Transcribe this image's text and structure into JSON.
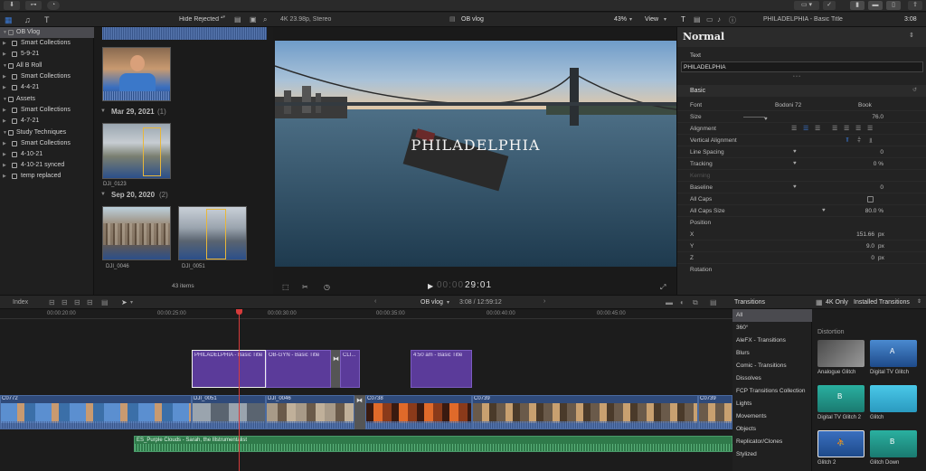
{
  "browser": {
    "filter": "Hide Rejected",
    "items_count": "43 items",
    "date1": "Mar 29, 2021",
    "date1_count": "(1)",
    "date2": "Sep 20, 2020",
    "date2_count": "(2)",
    "clip1": "DJI_0123",
    "clip2": "DJI_0046",
    "clip3": "DJI_0051"
  },
  "library": {
    "items": [
      {
        "label": "OB Vlog",
        "level": 0,
        "selected": true
      },
      {
        "label": "Smart Collections",
        "level": 1
      },
      {
        "label": "5-9-21",
        "level": 1
      },
      {
        "label": "All B Roll",
        "level": 0
      },
      {
        "label": "Smart Collections",
        "level": 1
      },
      {
        "label": "4-4-21",
        "level": 1
      },
      {
        "label": "Assets",
        "level": 0
      },
      {
        "label": "Smart Collections",
        "level": 1
      },
      {
        "label": "4-7-21",
        "level": 1
      },
      {
        "label": "Study Techniques",
        "level": 0
      },
      {
        "label": "Smart Collections",
        "level": 1
      },
      {
        "label": "4-10-21",
        "level": 1
      },
      {
        "label": "4-10-21 synced",
        "level": 1
      },
      {
        "label": "temp replaced",
        "level": 1
      }
    ]
  },
  "viewer": {
    "format": "4K 23.98p, Stereo",
    "project": "OB vlog",
    "zoom": "43%",
    "view": "View",
    "title_text": "PHILADELPHIA",
    "timecode_dim": "00:00",
    "timecode": "29:01"
  },
  "inspector": {
    "header_title": "PHILADELPHIA - Basic Title",
    "header_time": "3:08",
    "preset": "Normal",
    "text_label": "Text",
    "text_value": "PHILADELPHIA",
    "basic": "Basic",
    "rows": [
      {
        "k": "Font",
        "v": "Bodoni 72",
        "v2": "Book"
      },
      {
        "k": "Size",
        "v": "76.0"
      },
      {
        "k": "Alignment",
        "v": ""
      },
      {
        "k": "Vertical Alignment",
        "v": ""
      },
      {
        "k": "Line Spacing",
        "v": "0"
      },
      {
        "k": "Tracking",
        "v": "0 %"
      },
      {
        "k": "Kerning",
        "v": ""
      },
      {
        "k": "Baseline",
        "v": "0"
      },
      {
        "k": "All Caps",
        "v": ""
      },
      {
        "k": "All Caps Size",
        "v": "80.0 %"
      }
    ],
    "position": "Position",
    "x_label": "X",
    "x_val": "151.66",
    "x_unit": "px",
    "y_label": "Y",
    "y_val": "9.0",
    "y_unit": "px",
    "z_label": "Z",
    "z_val": "0",
    "z_unit": "px",
    "rotation": "Rotation"
  },
  "timeline": {
    "index": "Index",
    "project": "OB vlog",
    "timecode": "3:08 / 12:59:12",
    "ruler": [
      "00:00:20:00",
      "00:00:25:00",
      "00:00:30:00",
      "00:00:35:00",
      "00:00:40:00",
      "00:00:45:00"
    ],
    "titles": [
      "PHILADELPHIA - Basic Title",
      "OB-GYN - Basic Title",
      "CLI...",
      "4:50 am - Basic Title"
    ],
    "clips": [
      "C0772",
      "DJI_0051",
      "DJI_0046",
      "C0738",
      "C0739",
      "C0739"
    ],
    "audio": "ES_Purple Clouds - Sarah, the Illstrumentalist"
  },
  "transitions": {
    "header": "Transitions",
    "filter": "4K Only",
    "installed": "Installed Transitions",
    "categories": [
      "All",
      "360°",
      "AleFX - Transitions",
      "Blurs",
      "Comic - Transitions",
      "Dissolves",
      "FCP Transitions Collection",
      "Lights",
      "Movements",
      "Objects",
      "Replicator/Clones",
      "Stylized"
    ],
    "group": "Distortion",
    "items": [
      "Analogue Glitch",
      "Digital TV Glitch",
      "Digital TV Glitch 2",
      "Glitch",
      "Glitch 2",
      "Glitch Down"
    ]
  },
  "colors": {
    "accent": "#3b7bd9",
    "title_clip": "#5b3b9a",
    "video_clip": "#2f4a7a",
    "audio_clip": "#2f7a4a",
    "playhead": "#d63b3b"
  }
}
